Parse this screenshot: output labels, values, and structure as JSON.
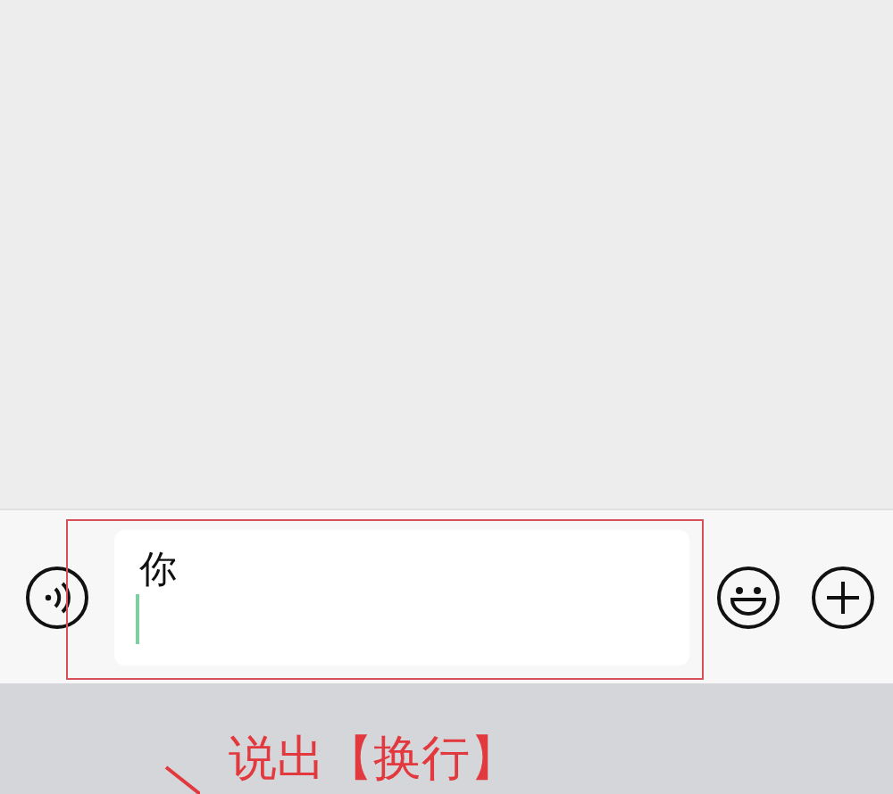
{
  "input_bar": {
    "value": "你"
  },
  "annotation": {
    "text": "说出【换行】"
  }
}
